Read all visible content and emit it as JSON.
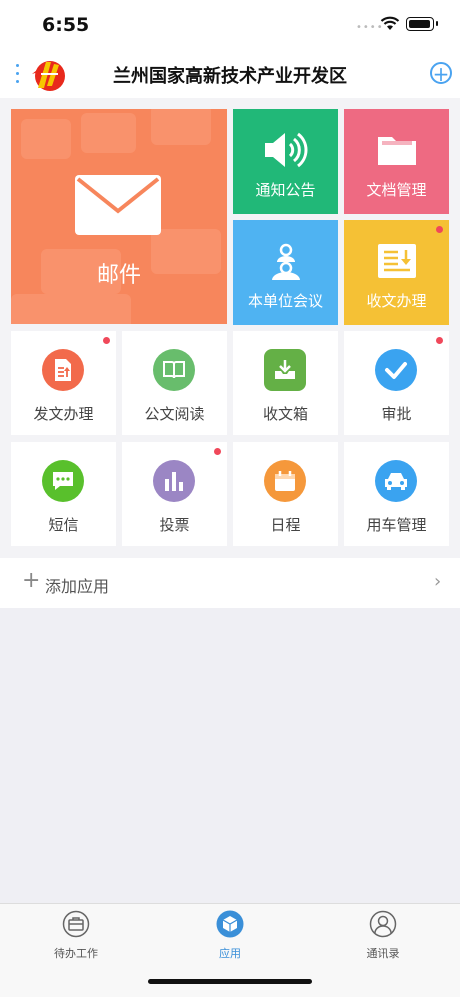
{
  "status_bar": {
    "time": "6:55"
  },
  "header": {
    "title": "兰州国家高新技术产业开发区"
  },
  "featured": {
    "mail": "邮件",
    "notice": "通知公告",
    "documents": "文档管理",
    "meeting": "本单位会议",
    "receive": "收文办理"
  },
  "apps": [
    {
      "label": "发文办理",
      "icon": "send-document-icon",
      "color": "#f26a4b",
      "badge": true
    },
    {
      "label": "公文阅读",
      "icon": "book-icon",
      "color": "#68bd6c",
      "badge": false
    },
    {
      "label": "收文箱",
      "icon": "inbox-download-icon",
      "color": "#64b046",
      "badge": false
    },
    {
      "label": "审批",
      "icon": "check-icon",
      "color": "#3aa3f0",
      "badge": true
    },
    {
      "label": "短信",
      "icon": "sms-icon",
      "color": "#59c02c",
      "badge": false
    },
    {
      "label": "投票",
      "icon": "bar-chart-icon",
      "color": "#9b86c4",
      "badge": true
    },
    {
      "label": "日程",
      "icon": "calendar-icon",
      "color": "#f5983b",
      "badge": false
    },
    {
      "label": "用车管理",
      "icon": "car-icon",
      "color": "#3aa3f0",
      "badge": false
    }
  ],
  "add_app": {
    "label": "添加应用"
  },
  "tabs": [
    {
      "label": "待办工作",
      "icon": "briefcase-icon"
    },
    {
      "label": "应用",
      "icon": "apps-cube-icon",
      "active": true
    },
    {
      "label": "通讯录",
      "icon": "contacts-icon"
    }
  ],
  "colors": {
    "accent": "#3a8fd8",
    "badge": "#f0485a"
  }
}
